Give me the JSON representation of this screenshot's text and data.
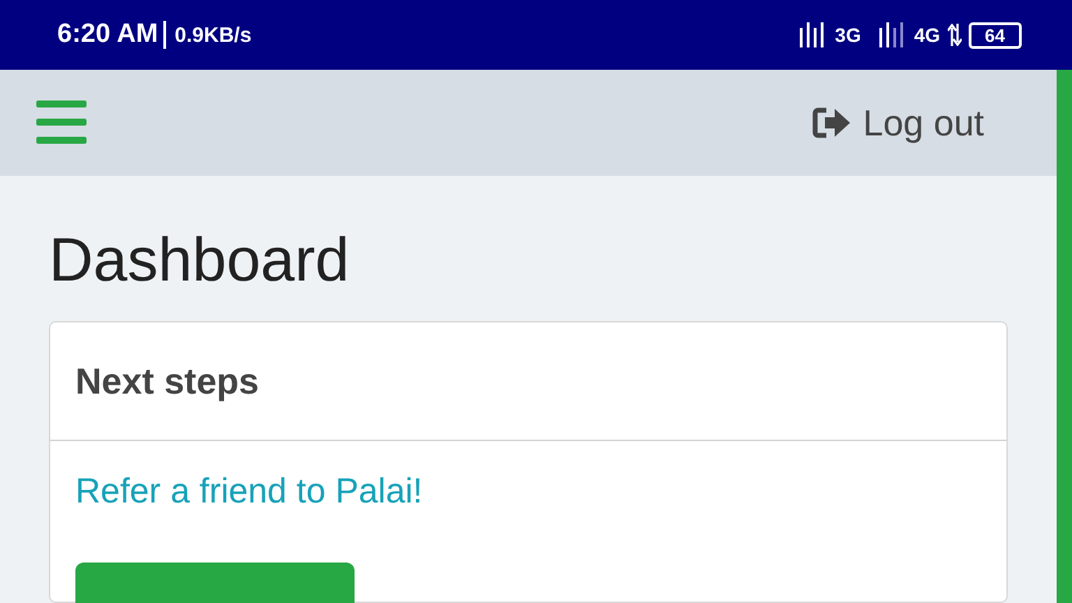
{
  "status_bar": {
    "time": "6:20 AM",
    "speed": "0.9KB/s",
    "network_1": "3G",
    "network_2": "4G",
    "battery": "64"
  },
  "header": {
    "logout": "Log out"
  },
  "page": {
    "title": "Dashboard"
  },
  "card": {
    "title": "Next steps",
    "link": "Refer a friend to Palai!"
  }
}
